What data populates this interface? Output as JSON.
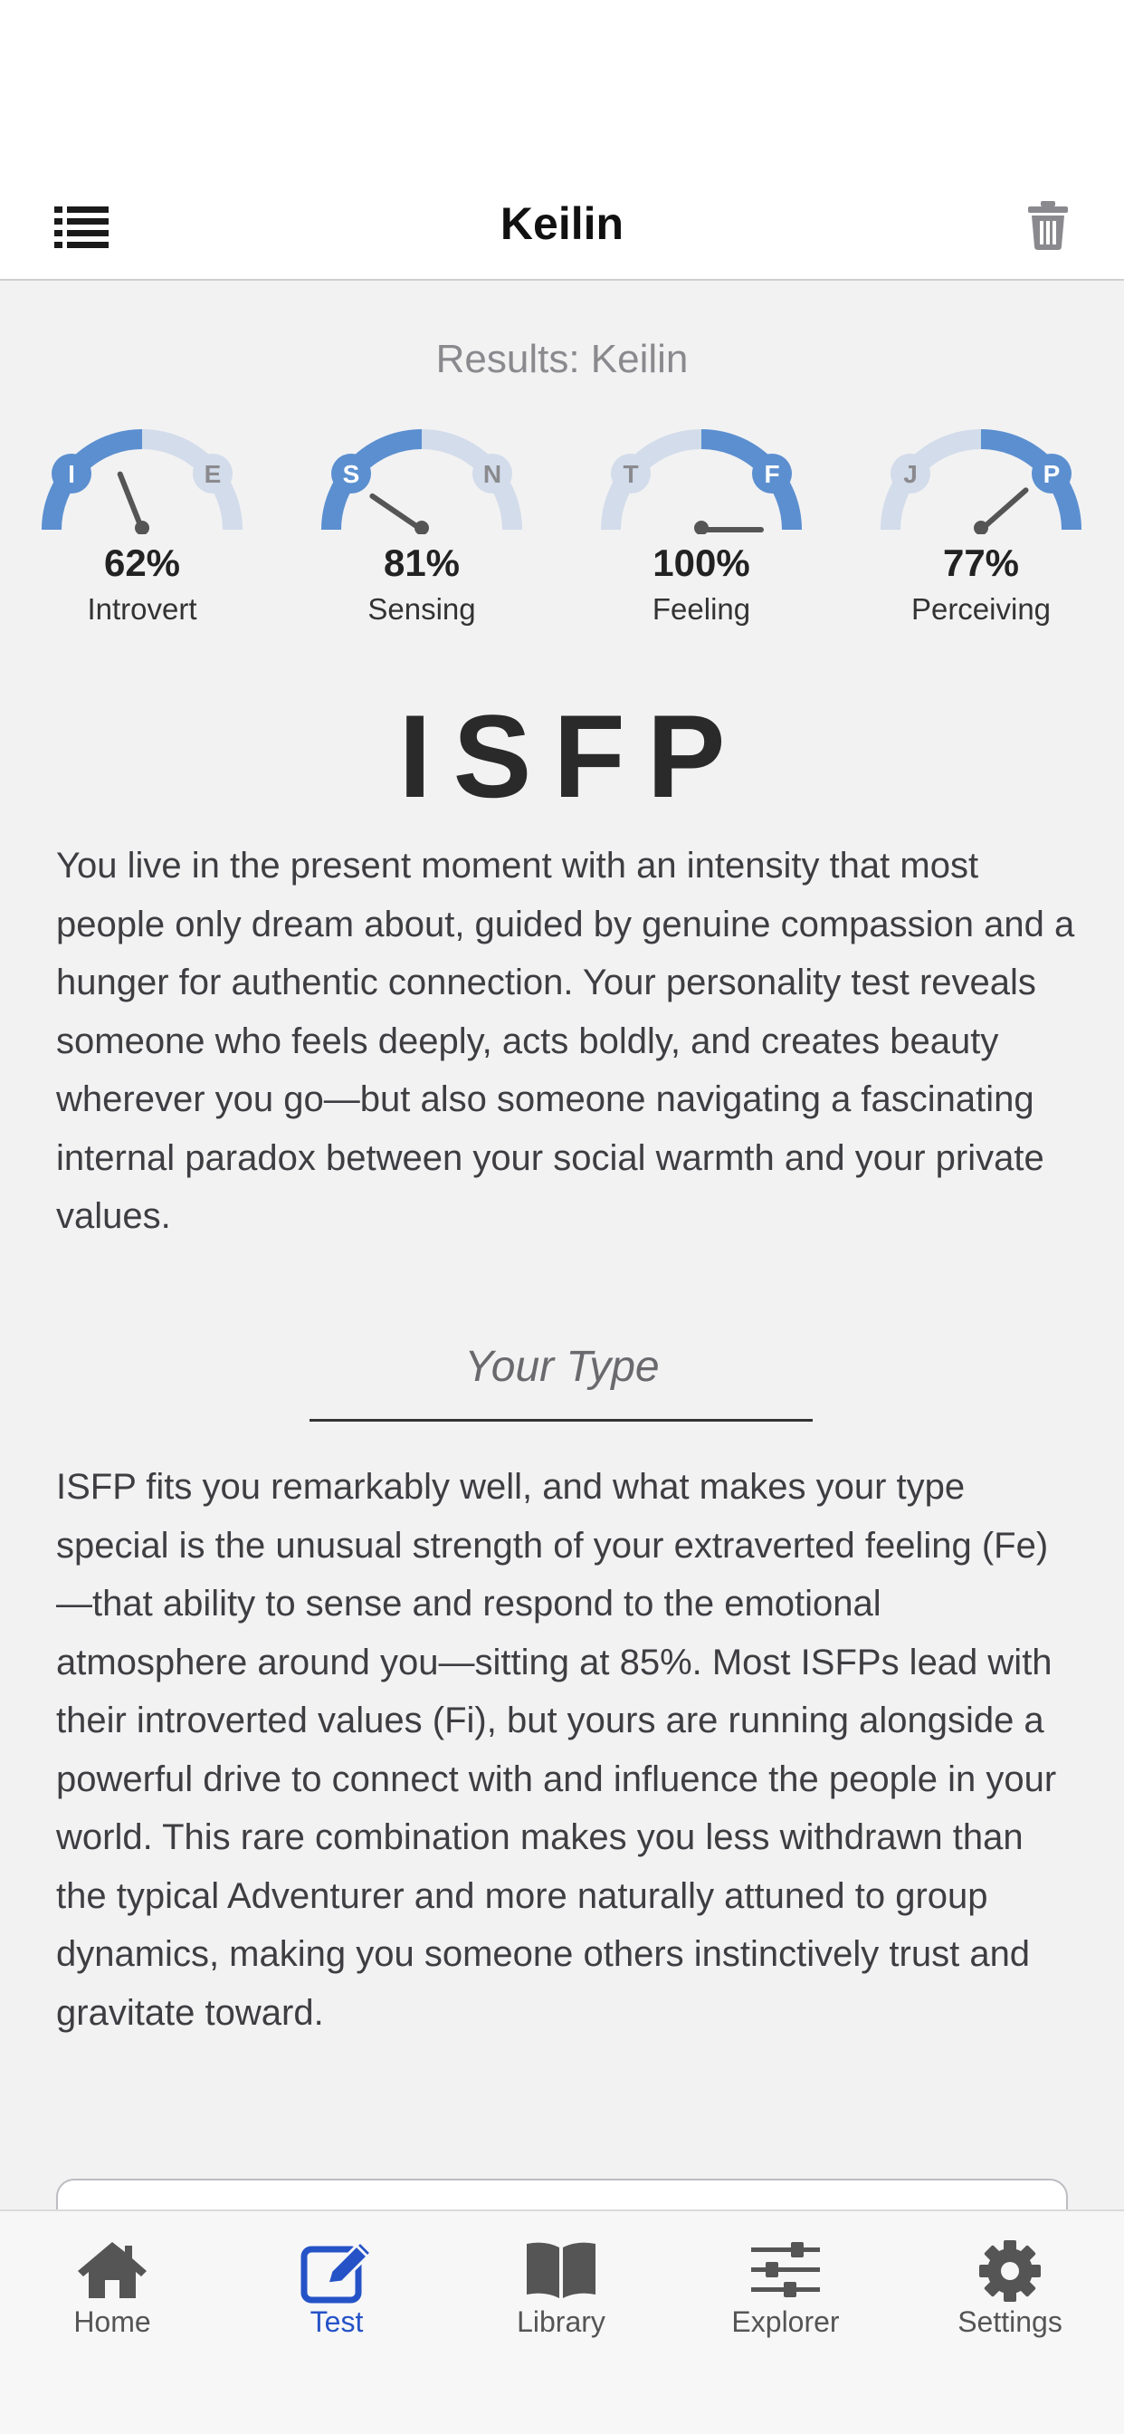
{
  "nav": {
    "title": "Keilin"
  },
  "results": {
    "title": "Results: Keilin"
  },
  "gauges": [
    {
      "left_letter": "I",
      "right_letter": "E",
      "percent": "62%",
      "label": "Introvert",
      "value": 62,
      "side": "left"
    },
    {
      "left_letter": "S",
      "right_letter": "N",
      "percent": "81%",
      "label": "Sensing",
      "value": 81,
      "side": "left"
    },
    {
      "left_letter": "T",
      "right_letter": "F",
      "percent": "100%",
      "label": "Feeling",
      "value": 100,
      "side": "right"
    },
    {
      "left_letter": "J",
      "right_letter": "P",
      "percent": "77%",
      "label": "Perceiving",
      "value": 77,
      "side": "right"
    }
  ],
  "type_code": "ISFP",
  "intro": "You live in the present moment with an intensity that most people only dream about, guided by genuine compassion and a hunger for authentic connection. Your personality test reveals someone who feels deeply, acts boldly, and creates beauty wherever you go—but also someone navigating a fascinating internal paradox between your social warmth and your private values.",
  "section": {
    "title": "Your Type",
    "body": "ISFP fits you remarkably well, and what makes your type special is the unusual strength of your extraverted feeling (Fe)—that ability to sense and respond to the emotional atmosphere around you—sitting at 85%. Most ISFPs lead with their introverted values (Fi), but yours are running alongside a powerful drive to connect with and influence the people in your world. This rare combination makes you less withdrawn than the typical Adventurer and more naturally attuned to group dynamics, making you someone others instinctively trust and gravitate toward."
  },
  "tabs": [
    {
      "label": "Home",
      "icon": "home-icon",
      "active": false
    },
    {
      "label": "Test",
      "icon": "pencil-square-icon",
      "active": true
    },
    {
      "label": "Library",
      "icon": "book-icon",
      "active": false
    },
    {
      "label": "Explorer",
      "icon": "sliders-icon",
      "active": false
    },
    {
      "label": "Settings",
      "icon": "gear-icon",
      "active": false
    }
  ],
  "colors": {
    "gauge_active": "#5b8fd0",
    "gauge_inactive": "#d3dcea",
    "tab_active": "#2553c7",
    "tab_inactive": "#555555"
  }
}
